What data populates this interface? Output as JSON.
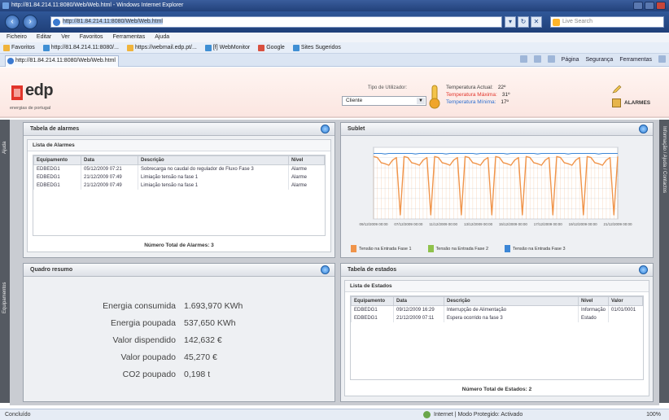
{
  "window": {
    "title": "http://81.84.214.11:8080/Web/Web.html - Windows Internet Explorer",
    "url": "http://81.84.214.11:8080/Web/Web.html",
    "search_placeholder": "Live Search"
  },
  "menubar": [
    "Ficheiro",
    "Editar",
    "Ver",
    "Favoritos",
    "Ferramentas",
    "Ajuda"
  ],
  "favorites": {
    "label": "Favoritos",
    "items": [
      "http://81.84.214.11:8080/...",
      "https://webmail.edp.pt/...",
      "[f] WebMonitor",
      "Google",
      "Sites Sugeridos"
    ]
  },
  "tab": {
    "label": "http://81.84.214.11:8080/Web/Web.html"
  },
  "cmdbar": [
    "Página",
    "Segurança",
    "Ferramentas"
  ],
  "header": {
    "logo": "edp",
    "logo_sub": "energias de portugal",
    "user_label": "Tipo de Utilizador:",
    "user_value": "Cliente",
    "temp_actual_label": "Temperatura Actual:",
    "temp_actual_value": "22º",
    "temp_max_label": "Temperatura Máxima:",
    "temp_max_value": "31º",
    "temp_min_label": "Temperatura Mínima:",
    "temp_min_value": "17º",
    "alerts_label": "ALARMES"
  },
  "rails": {
    "left_top": "Ajuda",
    "left_bottom": "Equipamentos",
    "right": "Informação / Ajuda / Contactos"
  },
  "alarms_panel": {
    "title": "Tabela de alarmes",
    "subtitle": "Lista de Alarmes",
    "columns": [
      "Equipamento",
      "Data",
      "Descrição",
      "Nível"
    ],
    "rows": [
      [
        "EDBEDG1",
        "05/12/2009 07:21",
        "Sobrecarga no caudal do regulador de Fluxo Fase 3",
        "Alarme"
      ],
      [
        "EDBEDG1",
        "21/12/2009 07:49",
        "Limiação tensão na fase 1",
        "Alarme"
      ],
      [
        "EDBEDG1",
        "21/12/2009 07:49",
        "Limiação tensão na fase 1",
        "Alarme"
      ]
    ],
    "total": "Número Total de Alarmes: 3"
  },
  "chart_panel": {
    "title": "Sublet"
  },
  "summary_panel": {
    "title": "Quadro resumo",
    "rows": [
      {
        "label": "Energia consumida",
        "value": "1.693,970 KWh"
      },
      {
        "label": "Energia poupada",
        "value": "537,650 KWh"
      },
      {
        "label": "Valor dispendido",
        "value": "142,632 €"
      },
      {
        "label": "Valor poupado",
        "value": "45,270 €"
      },
      {
        "label": "CO2 poupado",
        "value": "0,198 t"
      }
    ]
  },
  "states_panel": {
    "title": "Tabela de estados",
    "subtitle": "Lista de Estados",
    "columns": [
      "Equipamento",
      "Data",
      "Descrição",
      "Nível",
      "Valor"
    ],
    "rows": [
      [
        "EDBEDG1",
        "09/12/2009 16:29",
        "Interrupção de Alimentação",
        "Informação",
        "01/01/0001"
      ],
      [
        "EDBEDG1",
        "21/12/2009 07:11",
        "Espera ocorrido na fase 3",
        "Estado",
        ""
      ]
    ],
    "total": "Número Total de Estados: 2"
  },
  "statusbar": {
    "text": "Concluído",
    "zone": "Internet | Modo Protegido: Activado",
    "zoom": "100%"
  },
  "chart_data": {
    "type": "line",
    "title": "Sublet",
    "y_ticks": [
      "",
      "",
      "",
      "",
      "",
      "",
      "",
      ""
    ],
    "ylim": [
      0,
      140
    ],
    "x_ticks": [
      "09/12/2009 00:00",
      "07/12/2009 00:00",
      "11/12/2009 00:00",
      "13/12/2009 00:00",
      "15/12/2009 00:00",
      "17/12/2009 00:00",
      "19/12/2009 00:00",
      "21/12/2009 00:00"
    ],
    "colors": {
      "fase1": "#f0944a",
      "fase2": "#8fc24b",
      "fase3": "#3c86d6"
    },
    "legend": [
      "Tensão na Entrada Fase 1",
      "Tensão na Entrada Fase 2",
      "Tensão na Entrada Fase 3"
    ],
    "cycles": 8,
    "series": [
      {
        "name": "Tensão na Entrada Fase 1",
        "pattern": [
          122,
          120,
          110,
          108,
          105,
          115,
          120,
          8,
          122
        ]
      },
      {
        "name": "Tensão na Entrada Fase 3",
        "pattern": [
          128,
          128,
          128,
          127,
          128,
          128,
          128,
          128,
          128
        ]
      }
    ]
  }
}
